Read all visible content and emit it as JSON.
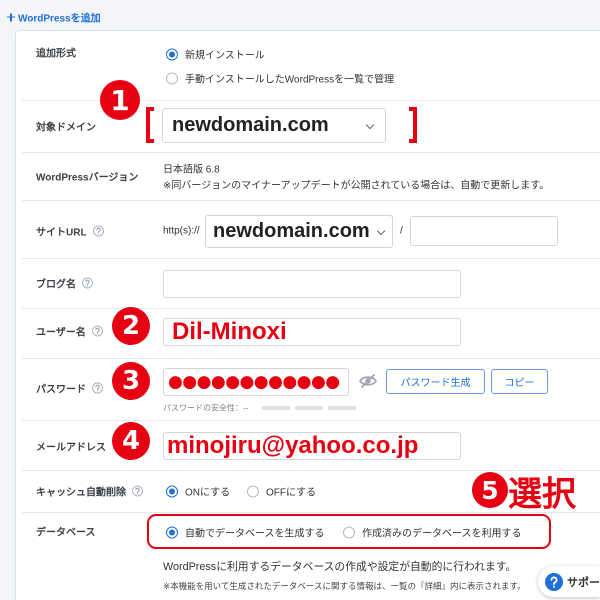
{
  "colors": {
    "accent": "#1f6fd6",
    "annotation": "#e60012",
    "text": "#333333"
  },
  "header": {
    "icon": "plus-icon",
    "title": "WordPressを追加"
  },
  "form": {
    "install_type": {
      "label": "追加形式",
      "options": [
        "新規インストール",
        "手動インストールしたWordPressを一覧で管理"
      ],
      "selected": 0
    },
    "domain": {
      "label": "対象ドメイン",
      "value": "newdomain.com",
      "icon": "chevron-down-icon"
    },
    "version": {
      "label": "WordPressバージョン",
      "value": "日本語版 6.8",
      "note": "※同バージョンのマイナーアップデートが公開されている場合は、自動で更新します。"
    },
    "site_url": {
      "label": "サイトURL",
      "prefix": "http(s)://",
      "domain": "newdomain.com",
      "separator": "/",
      "path": ""
    },
    "blog_name": {
      "label": "ブログ名",
      "value": ""
    },
    "username": {
      "label": "ユーザー名",
      "value": "Dil-Minoxi"
    },
    "password": {
      "label": "パスワード",
      "value": "●●●●●●●●●●●●",
      "visibility_icon": "eye-off-icon",
      "generate_label": "パスワード生成",
      "copy_label": "コピー",
      "strength_label": "パスワードの安全性：--",
      "strength_level": 0
    },
    "email": {
      "label": "メールアドレス",
      "value": "minojiru@yahoo.co.jp"
    },
    "cache_clear": {
      "label": "キャッシュ自動削除",
      "options": [
        "ONにする",
        "OFFにする"
      ],
      "selected": 0
    },
    "database": {
      "label": "データベース",
      "options": [
        "自動でデータベースを生成する",
        "作成済みのデータベースを利用する"
      ],
      "selected": 0,
      "description": "WordPressに利用するデータベースの作成や設定が自動的に行われます。",
      "note": "※本機能を用いて生成されたデータベースに関する情報は、一覧の『詳細』内に表示されます。"
    }
  },
  "annotations": {
    "steps": [
      "1",
      "2",
      "3",
      "4",
      "5"
    ],
    "select_label": "選択"
  },
  "support": {
    "icon": "help-circle-icon",
    "label": "サポー"
  }
}
